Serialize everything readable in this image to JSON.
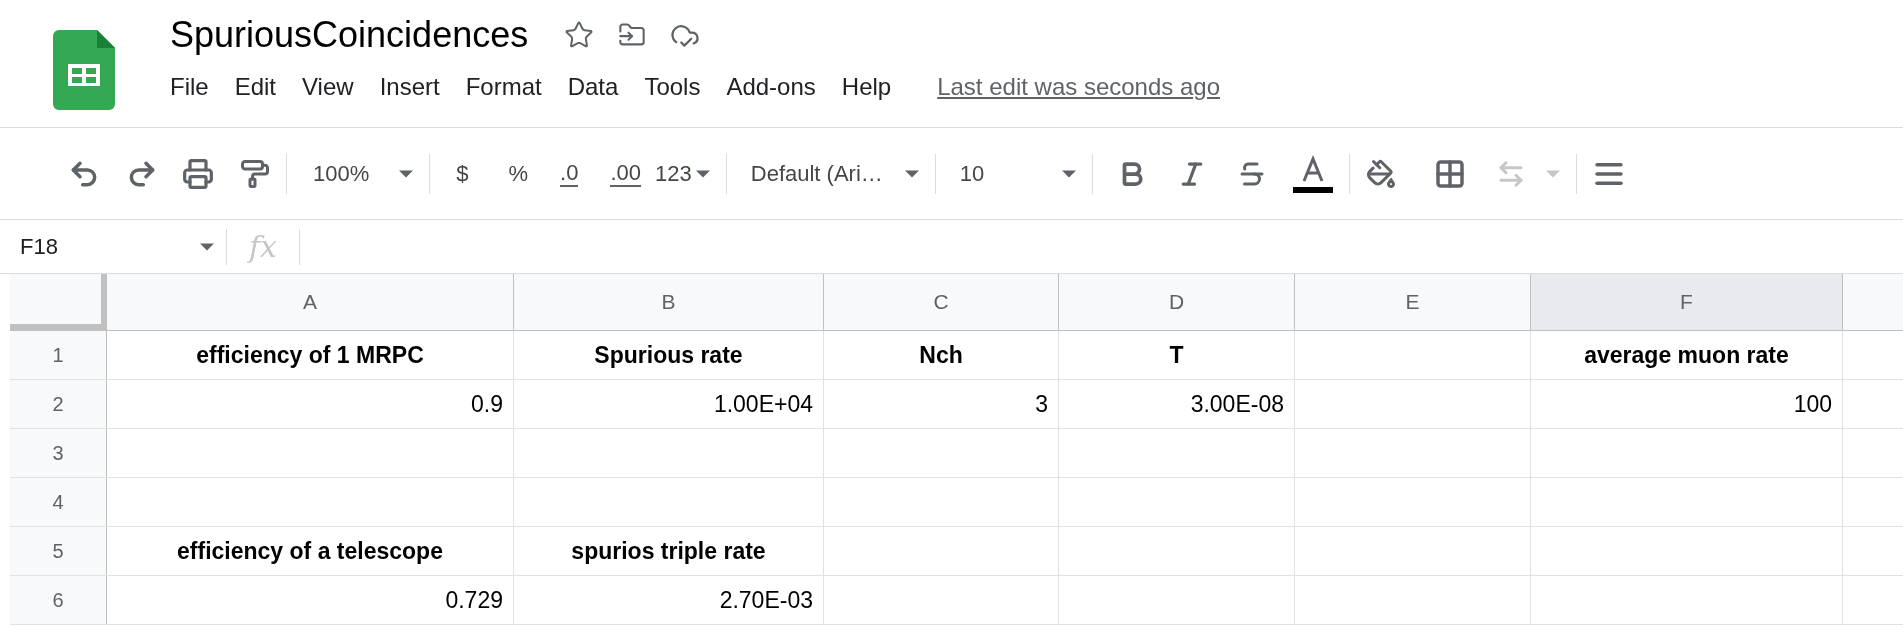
{
  "document": {
    "title": "SpuriousCoincidences",
    "starred": false
  },
  "menu": [
    "File",
    "Edit",
    "View",
    "Insert",
    "Format",
    "Data",
    "Tools",
    "Add-ons",
    "Help"
  ],
  "last_edit": "Last edit was seconds ago",
  "toolbar": {
    "zoom": "100%",
    "currency": "$",
    "percent": "%",
    "decrease_decimals": ".0",
    "increase_decimals": ".00",
    "number_format": "123",
    "font": "Default (Ari…",
    "font_size": "10"
  },
  "name_box": "F18",
  "formula_label": "fx",
  "columns": [
    {
      "letter": "A",
      "selected": false
    },
    {
      "letter": "B",
      "selected": false
    },
    {
      "letter": "C",
      "selected": false
    },
    {
      "letter": "D",
      "selected": false
    },
    {
      "letter": "E",
      "selected": false
    },
    {
      "letter": "F",
      "selected": true
    }
  ],
  "rows": [
    {
      "number": "1",
      "A": {
        "text": "efficiency of 1 MRPC",
        "bold": true
      },
      "B": {
        "text": "Spurious rate",
        "bold": true
      },
      "C": {
        "text": "Nch",
        "bold": true
      },
      "D": {
        "text": "T",
        "bold": true
      },
      "F": {
        "text": "average muon rate",
        "bold": true
      }
    },
    {
      "number": "2",
      "A": {
        "text": "0.9",
        "bold": false
      },
      "B": {
        "text": "1.00E+04",
        "bold": false
      },
      "C": {
        "text": "3",
        "bold": false
      },
      "D": {
        "text": "3.00E-08",
        "bold": false
      },
      "F": {
        "text": "100",
        "bold": false
      }
    },
    {
      "number": "3"
    },
    {
      "number": "4"
    },
    {
      "number": "5",
      "A": {
        "text": "efficiency of a telescope",
        "bold": true
      },
      "B": {
        "text": "spurios triple rate",
        "bold": true
      }
    },
    {
      "number": "6",
      "A": {
        "text": "0.729",
        "bold": false
      },
      "B": {
        "text": "2.70E-03",
        "bold": false
      }
    }
  ]
}
